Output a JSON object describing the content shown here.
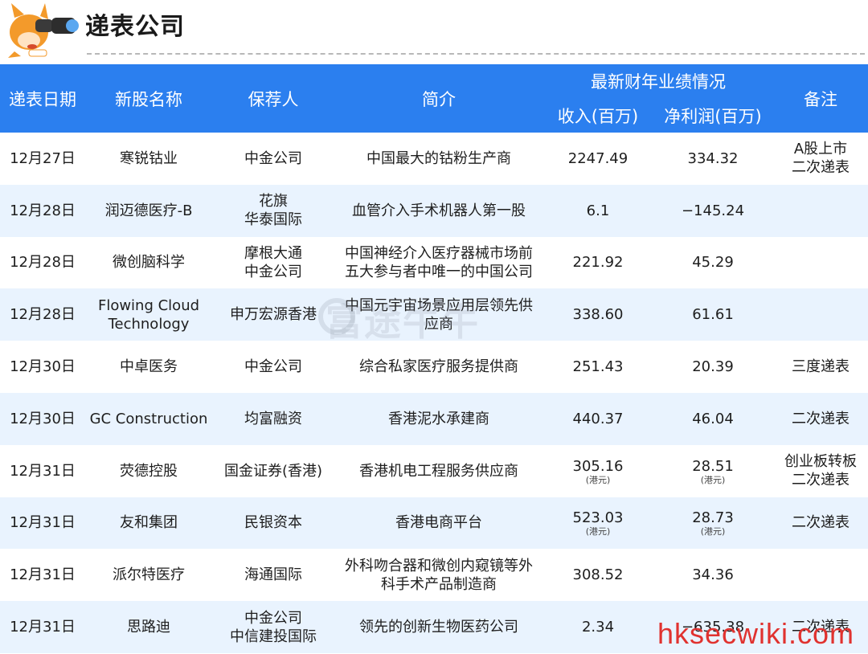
{
  "header": {
    "title": "递表公司"
  },
  "table": {
    "group_header": "最新财年业绩情况",
    "columns": {
      "date": "递表日期",
      "name": "新股名称",
      "sponsor": "保荐人",
      "desc": "简介",
      "revenue": "收入(百万)",
      "profit": "净利润(百万)",
      "note": "备注"
    },
    "rows": [
      {
        "date": "12月27日",
        "name": [
          "寒锐钴业"
        ],
        "sponsor": [
          "中金公司"
        ],
        "desc": [
          "中国最大的钴粉生产商"
        ],
        "revenue": "2247.49",
        "revenue_unit": "",
        "profit": "334.32",
        "profit_unit": "",
        "note": [
          "A股上市",
          "二次递表"
        ]
      },
      {
        "date": "12月28日",
        "name": [
          "润迈德医疗-B"
        ],
        "sponsor": [
          "花旗",
          "华泰国际"
        ],
        "desc": [
          "血管介入手术机器人第一股"
        ],
        "revenue": "6.1",
        "revenue_unit": "",
        "profit": "−145.24",
        "profit_unit": "",
        "note": []
      },
      {
        "date": "12月28日",
        "name": [
          "微创脑科学"
        ],
        "sponsor": [
          "摩根大通",
          "中金公司"
        ],
        "desc": [
          "中国神经介入医疗器械市场前",
          "五大参与者中唯一的中国公司"
        ],
        "revenue": "221.92",
        "revenue_unit": "",
        "profit": "45.29",
        "profit_unit": "",
        "note": []
      },
      {
        "date": "12月28日",
        "name": [
          "Flowing Cloud",
          "Technology"
        ],
        "sponsor": [
          "申万宏源香港"
        ],
        "desc": [
          "中国元宇宙场景应用层领先供",
          "应商"
        ],
        "revenue": "338.60",
        "revenue_unit": "",
        "profit": "61.61",
        "profit_unit": "",
        "note": []
      },
      {
        "date": "12月30日",
        "name": [
          "中卓医务"
        ],
        "sponsor": [
          "中金公司"
        ],
        "desc": [
          "综合私家医疗服务提供商"
        ],
        "revenue": "251.43",
        "revenue_unit": "",
        "profit": "20.39",
        "profit_unit": "",
        "note": [
          "三度递表"
        ]
      },
      {
        "date": "12月30日",
        "name": [
          "GC Construction"
        ],
        "sponsor": [
          "均富融资"
        ],
        "desc": [
          "香港泥水承建商"
        ],
        "revenue": "440.37",
        "revenue_unit": "",
        "profit": "46.04",
        "profit_unit": "",
        "note": [
          "二次递表"
        ]
      },
      {
        "date": "12月31日",
        "name": [
          "荧德控股"
        ],
        "sponsor": [
          "国金证券(香港)"
        ],
        "desc": [
          "香港机电工程服务供应商"
        ],
        "revenue": "305.16",
        "revenue_unit": "(港元)",
        "profit": "28.51",
        "profit_unit": "(港元)",
        "note": [
          "创业板转板",
          "二次递表"
        ]
      },
      {
        "date": "12月31日",
        "name": [
          "友和集团"
        ],
        "sponsor": [
          "民银资本"
        ],
        "desc": [
          "香港电商平台"
        ],
        "revenue": "523.03",
        "revenue_unit": "(港元)",
        "profit": "28.73",
        "profit_unit": "(港元)",
        "note": [
          "二次递表"
        ]
      },
      {
        "date": "12月31日",
        "name": [
          "派尔特医疗"
        ],
        "sponsor": [
          "海通国际"
        ],
        "desc": [
          "外科吻合器和微创内窥镜等外",
          "科手术产品制造商"
        ],
        "revenue": "308.52",
        "revenue_unit": "",
        "profit": "34.36",
        "profit_unit": "",
        "note": []
      },
      {
        "date": "12月31日",
        "name": [
          "思路迪"
        ],
        "sponsor": [
          "中金公司",
          "中信建投国际"
        ],
        "desc": [
          "领先的创新生物医药公司"
        ],
        "revenue": "2.34",
        "revenue_unit": "",
        "profit": "−635.38",
        "profit_unit": "",
        "note": [
          "二次递表"
        ]
      }
    ]
  },
  "watermarks": {
    "center": "富途牛牛",
    "site": "hksecwiki.com"
  },
  "colors": {
    "header_bg": "#2b7fef",
    "stripe": "#e9f3fe",
    "site_wm": "#e0322f",
    "mascot": "#f39a2b"
  }
}
